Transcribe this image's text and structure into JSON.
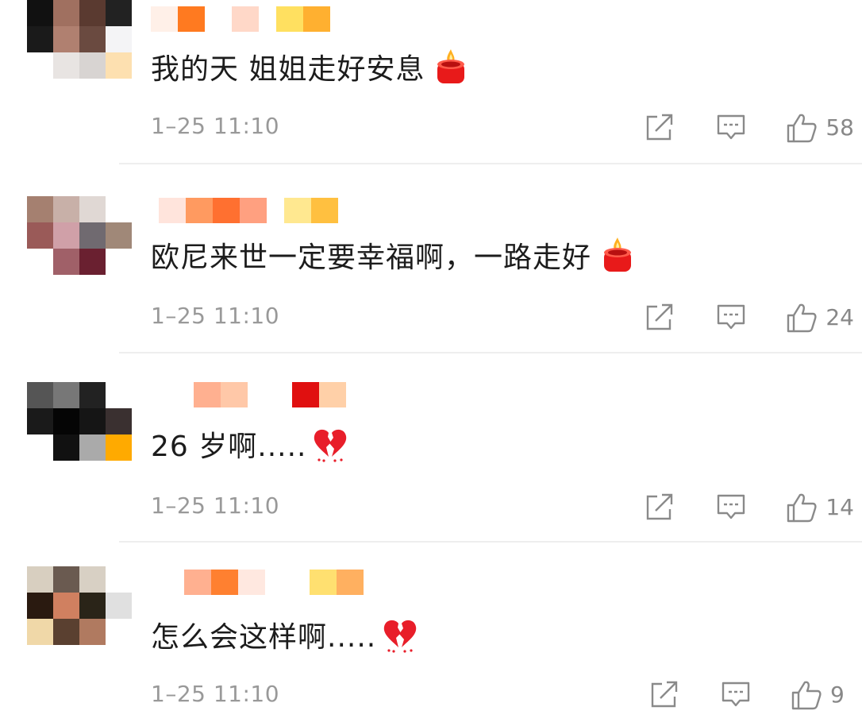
{
  "comments": [
    {
      "text": "我的天 姐姐走好安息",
      "emoji": "candle",
      "time": "1–25 11:10",
      "likes": "58",
      "avatar_colors": [
        "#111111",
        "#a07060",
        "#5a3a30",
        "#222222",
        "#1a1a1a",
        "#b08070",
        "#6a4a40",
        "#f4f4f6",
        "#ffffff",
        "#e8e4e2",
        "#d8d4d2",
        "#fde0b0"
      ],
      "name_colors": [
        "#fff0e8",
        "#ff7a20",
        "#ffffff",
        "#ffd8c8",
        "#ffe060",
        "#ffb030"
      ]
    },
    {
      "text": "欧尼来世一定要幸福啊，一路走好",
      "emoji": "candle",
      "time": "1–25 11:10",
      "likes": "24",
      "avatar_colors": [
        "#a58070",
        "#c8b0a8",
        "#e0d8d4",
        "#ffffff",
        "#9a5a58",
        "#d0a0a8",
        "#706a70",
        "#a08878",
        "#ffffff",
        "#a06068",
        "#6a2030",
        "#ffffff"
      ],
      "name_colors": [
        "#ffe4dc",
        "#ff9a60",
        "#ff7030",
        "#ffa080",
        "#ffe890",
        "#ffc040"
      ]
    },
    {
      "text": "26 岁啊.....",
      "emoji": "broken-heart",
      "time": "1–25 11:10",
      "likes": "14",
      "avatar_colors": [
        "#555555",
        "#777777",
        "#222222",
        "#ffffff",
        "#1a1a1a",
        "#050505",
        "#151515",
        "#3a3030",
        "#ffffff",
        "#111111",
        "#aaaaaa",
        "#ffaa00"
      ],
      "name_colors": [
        "#ffffff",
        "#ffb090",
        "#ffc8a8",
        "#ffffff",
        "#e01010",
        "#ffd0a8"
      ]
    },
    {
      "text": "怎么会这样啊.....",
      "emoji": "broken-heart",
      "time": "1–25 11:10",
      "likes": "9",
      "avatar_colors": [
        "#d8cfc0",
        "#6a5a50",
        "#d8d0c4",
        "#ffffff",
        "#2a1a10",
        "#d08060",
        "#2a2418",
        "#e0e0e0",
        "#f0d8a8",
        "#5a4030",
        "#b07a60",
        "#ffffff"
      ],
      "name_colors": [
        "#ffb090",
        "#ff8030",
        "#ffe8e0",
        "#ffffff",
        "#ffe070",
        "#ffb060"
      ]
    }
  ],
  "colors": {
    "text": "#1c1c1c",
    "meta": "#999999",
    "divider": "#eeeeee",
    "icon": "#8a8a8a"
  }
}
